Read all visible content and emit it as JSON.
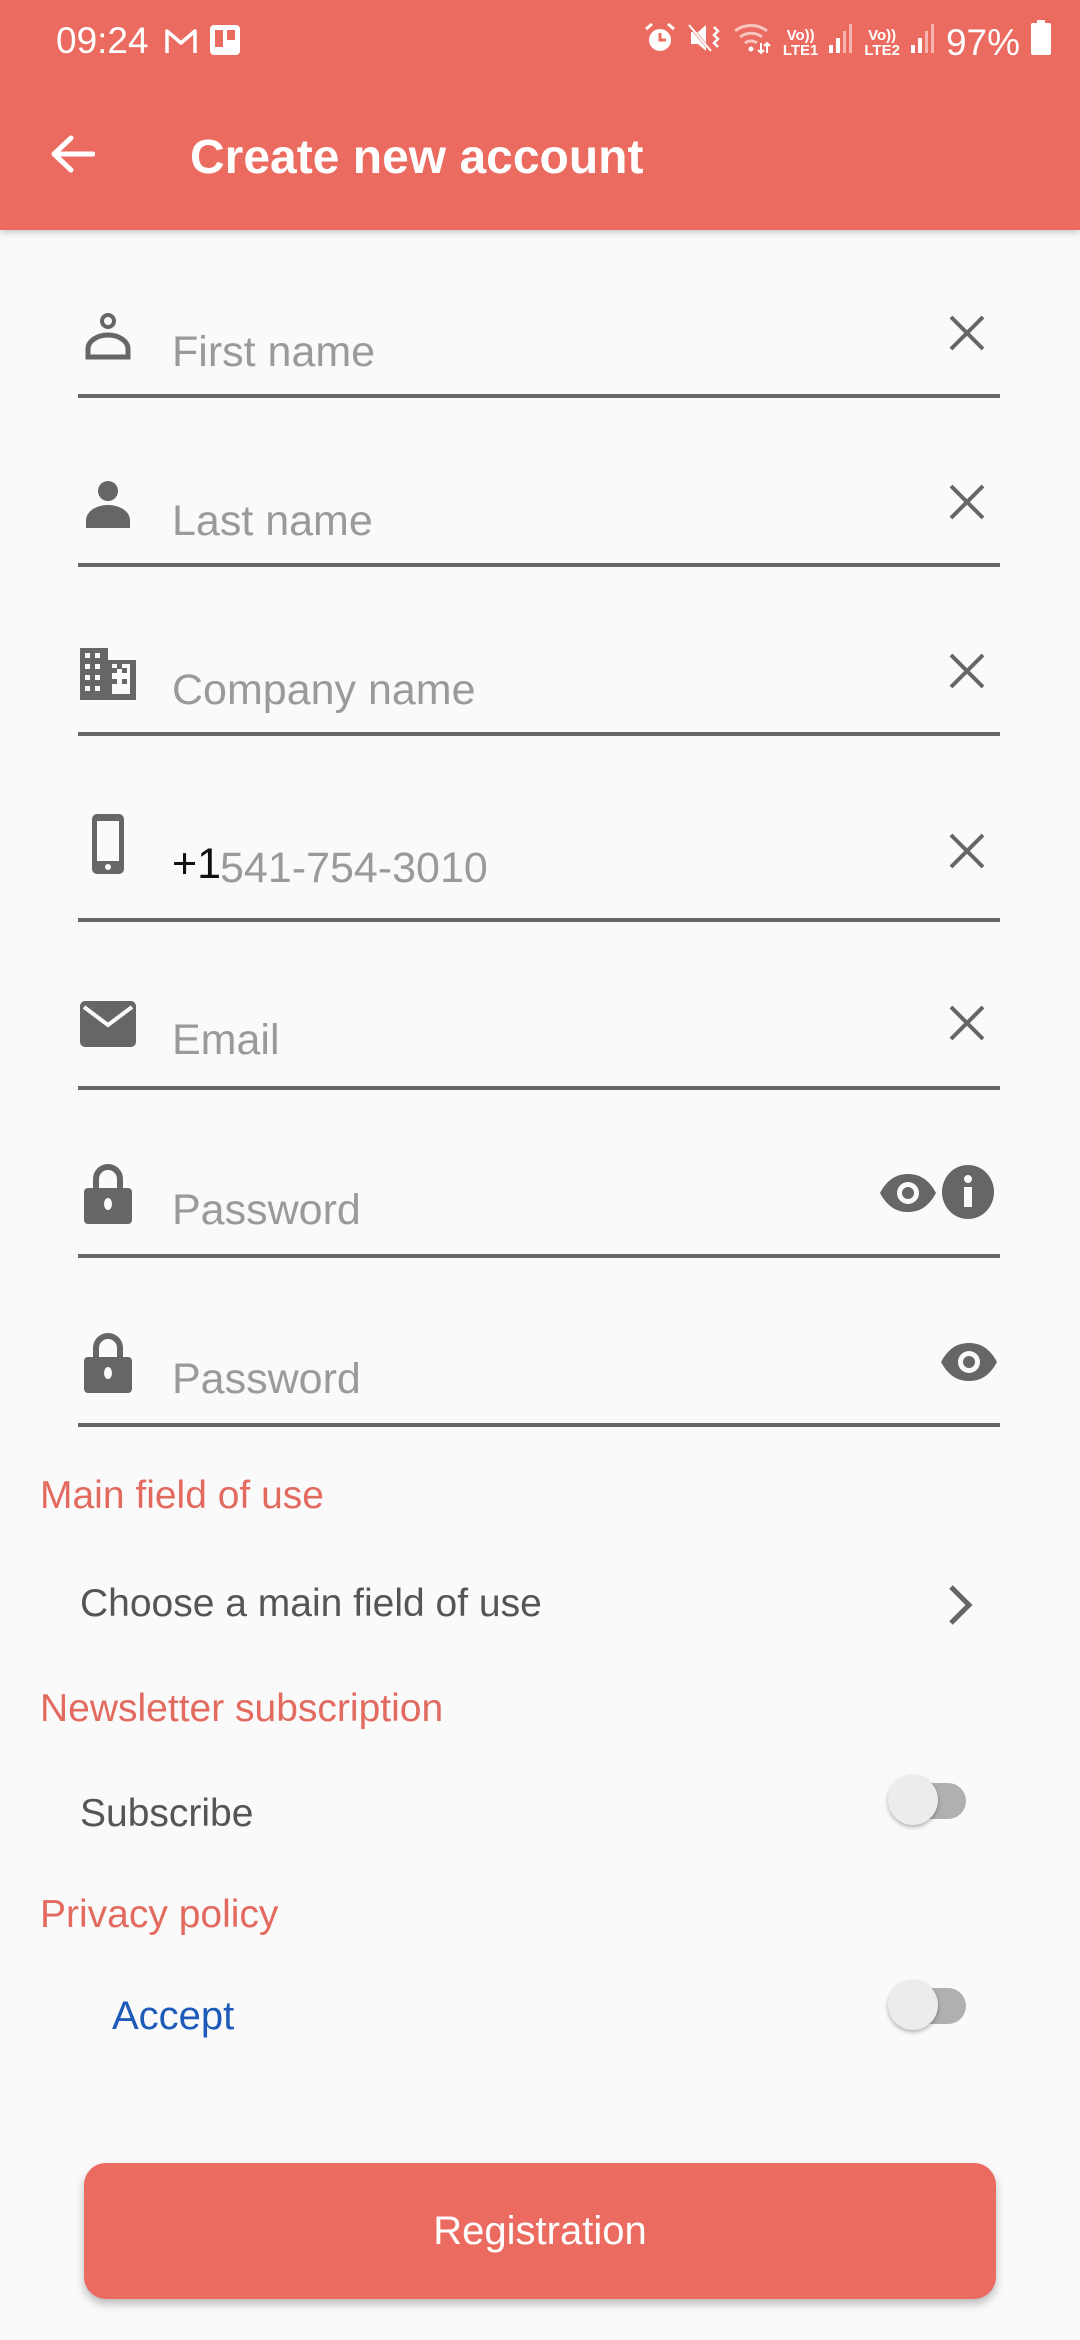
{
  "status_bar": {
    "time": "09:24",
    "left_icons": [
      "gmail-icon",
      "trello-icon"
    ],
    "right_icons": [
      "alarm-icon",
      "mute-vibrate-icon",
      "wifi-icon"
    ],
    "sim1_label_top": "Vo))",
    "sim1_label_bottom": "LTE1",
    "sim2_label_top": "Vo))",
    "sim2_label_bottom": "LTE2",
    "battery_percent": "97%"
  },
  "app_bar": {
    "title": "Create new account",
    "back_icon": "arrow-left-icon"
  },
  "form": {
    "first_name": {
      "placeholder": "First name",
      "value": "",
      "icon": "person-outline-icon"
    },
    "last_name": {
      "placeholder": "Last name",
      "value": "",
      "icon": "person-icon"
    },
    "company_name": {
      "placeholder": "Company name",
      "value": "",
      "icon": "business-icon"
    },
    "phone": {
      "prefix": "+1",
      "placeholder": "541-754-3010",
      "value": "",
      "icon": "smartphone-icon"
    },
    "email": {
      "placeholder": "Email",
      "value": "",
      "icon": "mail-icon"
    },
    "password": {
      "placeholder": "Password",
      "value": "",
      "icon": "lock-icon"
    },
    "password_confirm": {
      "placeholder": "Password",
      "value": "",
      "icon": "lock-icon"
    }
  },
  "sections": {
    "main_field": {
      "title": "Main field of use",
      "row_label": "Choose a main field of use"
    },
    "newsletter": {
      "title": "Newsletter subscription",
      "row_label": "Subscribe",
      "toggle_on": false
    },
    "privacy": {
      "title": "Privacy policy",
      "row_label": "Accept",
      "toggle_on": false
    }
  },
  "actions": {
    "register_label": "Registration"
  },
  "colors": {
    "primary": "#ec6b60",
    "section_title": "#e26a5f",
    "link_blue": "#1e5bb8",
    "icon_gray": "#666666",
    "background": "#fafafa"
  }
}
